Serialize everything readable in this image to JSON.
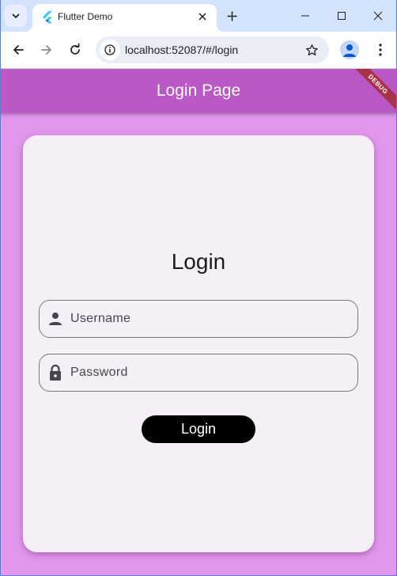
{
  "browser": {
    "tab_title": "Flutter Demo",
    "url": "localhost:52087/#/login",
    "icons": {
      "tab_search": "chevron-down-icon",
      "favicon": "flutter-logo-icon",
      "tab_close": "close-icon",
      "new_tab": "plus-icon",
      "minimize": "minimize-icon",
      "maximize": "maximize-icon",
      "window_close": "close-icon",
      "back": "arrow-left-icon",
      "forward": "arrow-right-icon",
      "reload": "reload-icon",
      "site_info": "info-icon",
      "bookmark": "star-icon",
      "profile": "person-icon",
      "menu": "more-vert-icon"
    }
  },
  "app": {
    "appbar_title": "Login Page",
    "debug_banner": "DEBUG",
    "colors": {
      "appbar": "#ba58c6",
      "background": "#e097ec",
      "card": "#f6eff8",
      "button": "#000000",
      "debug_banner": "#a8324a"
    },
    "login": {
      "heading": "Login",
      "username": {
        "value": "",
        "placeholder": "Username",
        "icon": "person-icon"
      },
      "password": {
        "value": "",
        "placeholder": "Password",
        "icon": "lock-icon"
      },
      "button_label": "Login"
    }
  }
}
